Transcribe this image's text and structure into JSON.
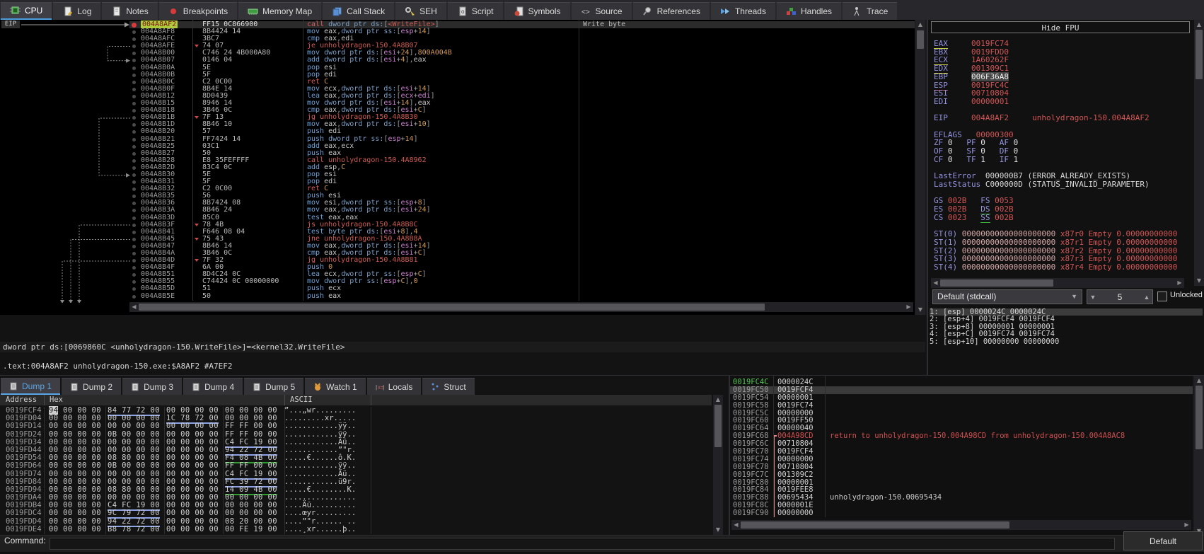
{
  "main_tabs": {
    "active": "CPU",
    "items": [
      {
        "label": "CPU",
        "icon": "cpu-icon"
      },
      {
        "label": "Log",
        "icon": "log-icon"
      },
      {
        "label": "Notes",
        "icon": "notes-icon"
      },
      {
        "label": "Breakpoints",
        "icon": "breakpoint-icon"
      },
      {
        "label": "Memory Map",
        "icon": "memory-map-icon"
      },
      {
        "label": "Call Stack",
        "icon": "call-stack-icon"
      },
      {
        "label": "SEH",
        "icon": "seh-icon"
      },
      {
        "label": "Script",
        "icon": "script-icon"
      },
      {
        "label": "Symbols",
        "icon": "symbols-icon"
      },
      {
        "label": "Source",
        "icon": "source-icon"
      },
      {
        "label": "References",
        "icon": "references-icon"
      },
      {
        "label": "Threads",
        "icon": "threads-icon"
      },
      {
        "label": "Handles",
        "icon": "handles-icon"
      },
      {
        "label": "Trace",
        "icon": "trace-icon"
      }
    ]
  },
  "disasm": {
    "eip_label": "EIP",
    "info_line": "dword ptr ds:[0069860C <unholydragon-150.WriteFile>]=<kernel32.WriteFile>",
    "location_line": ".text:004A8AF2 unholydragon-150.exe:$A8AF2 #A7EF2",
    "rows": [
      {
        "addr": "004A8AF2",
        "bytes": "FF15 0C866900",
        "text": "call dword ptr ds:[<WriteFile>]",
        "comment": "Write byte",
        "eip": true
      },
      {
        "addr": "004A8AF8",
        "bytes": "8B4424 14",
        "text": "mov eax,dword ptr ss:[esp+14]"
      },
      {
        "addr": "004A8AFC",
        "bytes": "3BC7",
        "text": "cmp eax,edi"
      },
      {
        "addr": "004A8AFE",
        "bytes": "74 07",
        "text": "je unholydragon-150.4A8B07",
        "chev": true
      },
      {
        "addr": "004A8B00",
        "bytes": "C746 24 4B000A80",
        "text": "mov dword ptr ds:[esi+24],800A004B"
      },
      {
        "addr": "004A8B07",
        "bytes": "0146 04",
        "text": "add dword ptr ds:[esi+4],eax"
      },
      {
        "addr": "004A8B0A",
        "bytes": "5E",
        "text": "pop esi"
      },
      {
        "addr": "004A8B0B",
        "bytes": "5F",
        "text": "pop edi"
      },
      {
        "addr": "004A8B0C",
        "bytes": "C2 0C00",
        "text": "ret C"
      },
      {
        "addr": "004A8B0F",
        "bytes": "8B4E 14",
        "text": "mov ecx,dword ptr ds:[esi+14]"
      },
      {
        "addr": "004A8B12",
        "bytes": "8D0439",
        "text": "lea eax,dword ptr ds:[ecx+edi]"
      },
      {
        "addr": "004A8B15",
        "bytes": "8946 14",
        "text": "mov dword ptr ds:[esi+14],eax"
      },
      {
        "addr": "004A8B18",
        "bytes": "3B46 0C",
        "text": "cmp eax,dword ptr ds:[esi+C]"
      },
      {
        "addr": "004A8B1B",
        "bytes": "7F 13",
        "text": "jg unholydragon-150.4A8B30",
        "chev": true
      },
      {
        "addr": "004A8B1D",
        "bytes": "8B46 10",
        "text": "mov eax,dword ptr ds:[esi+10]"
      },
      {
        "addr": "004A8B20",
        "bytes": "57",
        "text": "push edi"
      },
      {
        "addr": "004A8B21",
        "bytes": "FF7424 14",
        "text": "push dword ptr ss:[esp+14]"
      },
      {
        "addr": "004A8B25",
        "bytes": "03C1",
        "text": "add eax,ecx"
      },
      {
        "addr": "004A8B27",
        "bytes": "50",
        "text": "push eax"
      },
      {
        "addr": "004A8B28",
        "bytes": "E8 35FEFFFF",
        "text": "call unholydragon-150.4A8962"
      },
      {
        "addr": "004A8B2D",
        "bytes": "83C4 0C",
        "text": "add esp,C"
      },
      {
        "addr": "004A8B30",
        "bytes": "5E",
        "text": "pop esi"
      },
      {
        "addr": "004A8B31",
        "bytes": "5F",
        "text": "pop edi"
      },
      {
        "addr": "004A8B32",
        "bytes": "C2 0C00",
        "text": "ret C"
      },
      {
        "addr": "004A8B35",
        "bytes": "56",
        "text": "push esi"
      },
      {
        "addr": "004A8B36",
        "bytes": "8B7424 08",
        "text": "mov esi,dword ptr ss:[esp+8]"
      },
      {
        "addr": "004A8B3A",
        "bytes": "8B46 24",
        "text": "mov eax,dword ptr ds:[esi+24]"
      },
      {
        "addr": "004A8B3D",
        "bytes": "85C0",
        "text": "test eax,eax"
      },
      {
        "addr": "004A8B3F",
        "bytes": "78 4B",
        "text": "js unholydragon-150.4A8B8C",
        "chev": true
      },
      {
        "addr": "004A8B41",
        "bytes": "F646 08 04",
        "text": "test byte ptr ds:[esi+8],4"
      },
      {
        "addr": "004A8B45",
        "bytes": "75 43",
        "text": "jne unholydragon-150.4A8B8A",
        "chev": true
      },
      {
        "addr": "004A8B47",
        "bytes": "8B46 14",
        "text": "mov eax,dword ptr ds:[esi+14]"
      },
      {
        "addr": "004A8B4A",
        "bytes": "3B46 0C",
        "text": "cmp eax,dword ptr ds:[esi+C]"
      },
      {
        "addr": "004A8B4D",
        "bytes": "7F 32",
        "text": "jg unholydragon-150.4A8B81",
        "chev": true
      },
      {
        "addr": "004A8B4F",
        "bytes": "6A 00",
        "text": "push 0"
      },
      {
        "addr": "004A8B51",
        "bytes": "8D4C24 0C",
        "text": "lea ecx,dword ptr ss:[esp+C]"
      },
      {
        "addr": "004A8B55",
        "bytes": "C74424 0C 00000000",
        "text": "mov dword ptr ss:[esp+C],0"
      },
      {
        "addr": "004A8B5D",
        "bytes": "51",
        "text": "push ecx"
      },
      {
        "addr": "004A8B5E",
        "bytes": "50",
        "text": "push eax"
      }
    ]
  },
  "registers": {
    "hide_fpu_label": "Hide FPU",
    "gpr": [
      {
        "name": "EAX",
        "value": "0019FC74",
        "underline": "y"
      },
      {
        "name": "EBX",
        "value": "0019FDD0"
      },
      {
        "name": "ECX",
        "value": "1A60262F",
        "underline": "y"
      },
      {
        "name": "EDX",
        "value": "001309C1",
        "underline": "y"
      },
      {
        "name": "EBP",
        "value": "006F36A8",
        "value_selected": true
      },
      {
        "name": "ESP",
        "value": "0019FC4C",
        "underline": "r"
      },
      {
        "name": "ESI",
        "value": "00710804"
      },
      {
        "name": "EDI",
        "value": "00000001"
      }
    ],
    "eip": {
      "name": "EIP",
      "value": "004A8AF2",
      "module": "unholydragon-150.004A8AF2"
    },
    "eflags": {
      "name": "EFLAGS",
      "value": "00000300"
    },
    "flags": [
      [
        "ZF",
        "0"
      ],
      [
        "PF",
        "0"
      ],
      [
        "AF",
        "0"
      ],
      [
        "OF",
        "0"
      ],
      [
        "SF",
        "0"
      ],
      [
        "DF",
        "0"
      ],
      [
        "CF",
        "0"
      ],
      [
        "TF",
        "1"
      ],
      [
        "IF",
        "1"
      ]
    ],
    "last_error": {
      "name": "LastError",
      "value": "000000B7",
      "text": "(ERROR_ALREADY_EXISTS)"
    },
    "last_status": {
      "name": "LastStatus",
      "value": "C000000D",
      "text": "(STATUS_INVALID_PARAMETER)"
    },
    "segments": [
      {
        "name": "GS",
        "value": "002B"
      },
      {
        "name": "FS",
        "value": "0053"
      },
      {
        "name": "ES",
        "value": "002B"
      },
      {
        "name": "DS",
        "value": "002B",
        "underline": "g"
      },
      {
        "name": "CS",
        "value": "0023"
      },
      {
        "name": "SS",
        "value": "002B",
        "underline": "g"
      }
    ],
    "st": [
      {
        "name": "ST(0)",
        "value": "00000000000000000000",
        "reg": "x87r0",
        "status": "Empty",
        "num": "0.00000000000"
      },
      {
        "name": "ST(1)",
        "value": "00000000000000000000",
        "reg": "x87r1",
        "status": "Empty",
        "num": "0.00000000000"
      },
      {
        "name": "ST(2)",
        "value": "00000000000000000000",
        "reg": "x87r2",
        "status": "Empty",
        "num": "0.00000000000"
      },
      {
        "name": "ST(3)",
        "value": "00000000000000000000",
        "reg": "x87r3",
        "status": "Empty",
        "num": "0.00000000000"
      },
      {
        "name": "ST(4)",
        "value": "00000000000000000000",
        "reg": "x87r4",
        "status": "Empty",
        "num": "0.00000000000"
      }
    ]
  },
  "callconv": {
    "convention": "Default (stdcall)",
    "depth": "5",
    "locked_label": "Unlocked",
    "args": [
      {
        "label": "1:",
        "expr": "[esp]",
        "v1": "0000024C",
        "v2": "0000024C",
        "selected": true
      },
      {
        "label": "2:",
        "expr": "[esp+4]",
        "v1": "0019FCF4",
        "v2": "0019FCF4"
      },
      {
        "label": "3:",
        "expr": "[esp+8]",
        "v1": "00000001",
        "v2": "00000001"
      },
      {
        "label": "4:",
        "expr": "[esp+C]",
        "v1": "0019FC74",
        "v2": "0019FC74"
      },
      {
        "label": "5:",
        "expr": "[esp+10]",
        "v1": "00000000",
        "v2": "00000000"
      }
    ]
  },
  "dump": {
    "active_tab": "Dump 1",
    "tabs": [
      {
        "label": "Dump 1",
        "icon": "dump-icon"
      },
      {
        "label": "Dump 2",
        "icon": "dump-icon"
      },
      {
        "label": "Dump 3",
        "icon": "dump-icon"
      },
      {
        "label": "Dump 4",
        "icon": "dump-icon"
      },
      {
        "label": "Dump 5",
        "icon": "dump-icon"
      },
      {
        "label": "Watch 1",
        "icon": "watch-icon"
      },
      {
        "label": "Locals",
        "icon": "locals-icon"
      },
      {
        "label": "Struct",
        "icon": "struct-icon"
      }
    ],
    "headers": [
      "Address",
      "Hex",
      "ASCII"
    ],
    "rows": [
      {
        "addr": "0019FCF4",
        "groups": [
          "94 00 00 00",
          "84 77 72 00",
          "00 00 00 00",
          "00 00 00 00"
        ],
        "ul": [
          null,
          "b",
          null,
          null
        ],
        "ascii": "”...„wr.........",
        "sel_first": true
      },
      {
        "addr": "0019FD04",
        "groups": [
          "00 00 00 00",
          "00 00 00 00",
          "1C 78 72 00",
          "00 00 00 00"
        ],
        "ul": [
          null,
          null,
          "b",
          null
        ],
        "ascii": ".........xr....."
      },
      {
        "addr": "0019FD14",
        "groups": [
          "00 00 00 00",
          "00 00 00 00",
          "00 00 00 00",
          "FF FF 00 00"
        ],
        "ul": [
          null,
          null,
          null,
          null
        ],
        "ascii": "............ÿÿ.."
      },
      {
        "addr": "0019FD24",
        "groups": [
          "00 00 00 00",
          "0B 00 00 00",
          "00 00 00 00",
          "FF FF 00 00"
        ],
        "ul": [
          null,
          null,
          null,
          null
        ],
        "ascii": "............ÿÿ.."
      },
      {
        "addr": "0019FD34",
        "groups": [
          "00 00 00 00",
          "00 00 00 00",
          "00 00 00 00",
          "C4 FC 19 00"
        ],
        "ul": [
          null,
          null,
          null,
          "b"
        ],
        "ascii": "............Äü.."
      },
      {
        "addr": "0019FD44",
        "groups": [
          "00 00 00 00",
          "00 00 00 00",
          "00 00 00 00",
          "94 22 72 00"
        ],
        "ul": [
          null,
          null,
          null,
          "b"
        ],
        "ascii": "............”\"r."
      },
      {
        "addr": "0019FD54",
        "groups": [
          "00 00 00 00",
          "08 80 00 00",
          "00 00 00 00",
          "F4 08 4B 00"
        ],
        "ul": [
          null,
          null,
          null,
          "g"
        ],
        "ascii": ".....€......ô.K."
      },
      {
        "addr": "0019FD64",
        "groups": [
          "00 00 00 00",
          "0B 00 00 00",
          "00 00 00 00",
          "FF FF 00 00"
        ],
        "ul": [
          null,
          null,
          null,
          null
        ],
        "ascii": "............ÿÿ.."
      },
      {
        "addr": "0019FD74",
        "groups": [
          "00 00 00 00",
          "00 00 00 00",
          "00 00 00 00",
          "C4 FC 19 00"
        ],
        "ul": [
          null,
          null,
          null,
          "b"
        ],
        "ascii": "............Äü.."
      },
      {
        "addr": "0019FD84",
        "groups": [
          "00 00 00 00",
          "00 00 00 00",
          "00 00 00 00",
          "FC 39 72 00"
        ],
        "ul": [
          null,
          null,
          null,
          "b"
        ],
        "ascii": "............ü9r."
      },
      {
        "addr": "0019FD94",
        "groups": [
          "00 00 00 00",
          "08 80 00 00",
          "00 00 00 00",
          "14 09 4B 00"
        ],
        "ul": [
          null,
          null,
          null,
          "g"
        ],
        "ascii": ".....€........K."
      },
      {
        "addr": "0019FDA4",
        "groups": [
          "00 00 00 00",
          "00 00 00 00",
          "00 00 00 00",
          "00 00 00 00"
        ],
        "ul": [
          null,
          null,
          null,
          null
        ],
        "ascii": "................"
      },
      {
        "addr": "0019FDB4",
        "groups": [
          "00 00 00 00",
          "C4 FC 19 00",
          "00 00 00 00",
          "00 00 00 00"
        ],
        "ul": [
          null,
          "b",
          null,
          null
        ],
        "ascii": "....Äü.........."
      },
      {
        "addr": "0019FDC4",
        "groups": [
          "00 00 00 00",
          "9C 79 72 00",
          "00 00 00 00",
          "00 00 00 00"
        ],
        "ul": [
          null,
          "b",
          null,
          null
        ],
        "ascii": "....œyr........."
      },
      {
        "addr": "0019FDD4",
        "groups": [
          "00 00 00 00",
          "94 22 72 00",
          "00 00 00 00",
          "08 20 00 00"
        ],
        "ul": [
          null,
          "b",
          null,
          null
        ],
        "ascii": "....”\"r...... .."
      },
      {
        "addr": "0019FDE4",
        "groups": [
          "00 00 00 00",
          "B8 78 72 00",
          "00 00 00 00",
          "00 FE 19 00"
        ],
        "ul": [
          null,
          null,
          null,
          null
        ],
        "ascii": "....¸xr......þ.."
      }
    ]
  },
  "stack": {
    "rows": [
      {
        "addr": "0019FC4C",
        "value": "0000024C",
        "csp": true
      },
      {
        "addr": "0019FC50",
        "value": "0019FCF4",
        "selected": true
      },
      {
        "addr": "0019FC54",
        "value": "00000001"
      },
      {
        "addr": "0019FC58",
        "value": "0019FC74"
      },
      {
        "addr": "0019FC5C",
        "value": "00000000"
      },
      {
        "addr": "0019FC60",
        "value": "0019FF50"
      },
      {
        "addr": "0019FC64",
        "value": "00000040"
      },
      {
        "addr": "0019FC68",
        "value": "004A98CD",
        "comment": "return to unholydragon-150.004A98CD from unholydragon-150.004A8AC8",
        "red": true,
        "bracket": "start"
      },
      {
        "addr": "0019FC6C",
        "value": "00710804",
        "bracket": "mid"
      },
      {
        "addr": "0019FC70",
        "value": "0019FCF4",
        "bracket": "mid"
      },
      {
        "addr": "0019FC74",
        "value": "00000000",
        "bracket": "mid"
      },
      {
        "addr": "0019FC78",
        "value": "00710804",
        "bracket": "mid"
      },
      {
        "addr": "0019FC7C",
        "value": "001309C2",
        "bracket": "mid"
      },
      {
        "addr": "0019FC80",
        "value": "00000001",
        "bracket": "mid"
      },
      {
        "addr": "0019FC84",
        "value": "0019FEE8",
        "bracket": "mid"
      },
      {
        "addr": "0019FC88",
        "value": "00695434",
        "comment": "unholydragon-150.00695434",
        "bracket": "mid"
      },
      {
        "addr": "0019FC8C",
        "value": "0000001E",
        "bracket": "mid"
      },
      {
        "addr": "0019FC90",
        "value": "00000000",
        "bracket": "mid"
      }
    ]
  },
  "command": {
    "label": "Command:",
    "value": "",
    "mode": "Default"
  }
}
